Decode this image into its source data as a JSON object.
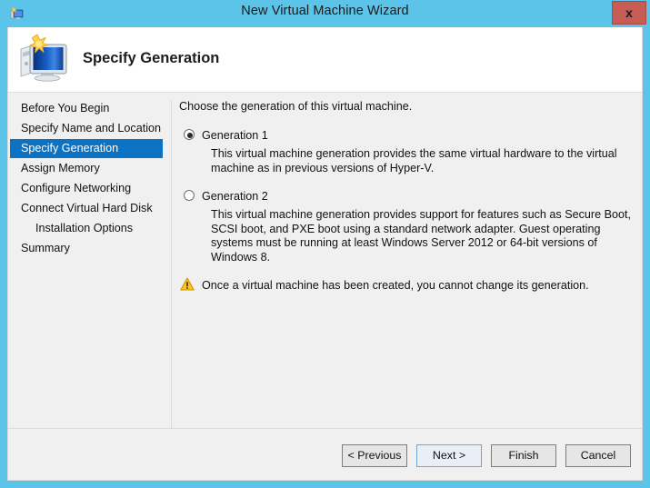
{
  "window": {
    "title": "New Virtual Machine Wizard",
    "icon": "virtual-machine-icon",
    "close_label": "x",
    "titlebar_color": "#5BC4E8",
    "close_color": "#C75B55"
  },
  "header": {
    "title": "Specify Generation",
    "icon": "new-virtual-machine-icon"
  },
  "sidebar": {
    "accent_color": "#0B72C4",
    "items": [
      {
        "label": "Before You Begin",
        "selected": false,
        "sub": false
      },
      {
        "label": "Specify Name and Location",
        "selected": false,
        "sub": false
      },
      {
        "label": "Specify Generation",
        "selected": true,
        "sub": false
      },
      {
        "label": "Assign Memory",
        "selected": false,
        "sub": false
      },
      {
        "label": "Configure Networking",
        "selected": false,
        "sub": false
      },
      {
        "label": "Connect Virtual Hard Disk",
        "selected": false,
        "sub": false
      },
      {
        "label": "Installation Options",
        "selected": false,
        "sub": true
      },
      {
        "label": "Summary",
        "selected": false,
        "sub": false
      }
    ]
  },
  "content": {
    "intro": "Choose the generation of this virtual machine.",
    "options": [
      {
        "label": "Generation 1",
        "selected": true,
        "description": "This virtual machine generation provides the same virtual hardware to the virtual machine as in previous versions of Hyper-V."
      },
      {
        "label": "Generation 2",
        "selected": false,
        "description": "This virtual machine generation provides support for features such as Secure Boot, SCSI boot, and PXE boot using a standard network adapter. Guest operating systems must be running at least Windows Server 2012 or 64-bit versions of Windows 8."
      }
    ],
    "warning": {
      "icon": "warning-triangle-icon",
      "text": "Once a virtual machine has been created, you cannot change its generation.",
      "color": "#FFC423"
    }
  },
  "footer": {
    "buttons": [
      {
        "label": "< Previous",
        "default": false
      },
      {
        "label": "Next >",
        "default": true
      },
      {
        "label": "Finish",
        "default": false
      },
      {
        "label": "Cancel",
        "default": false
      }
    ]
  }
}
